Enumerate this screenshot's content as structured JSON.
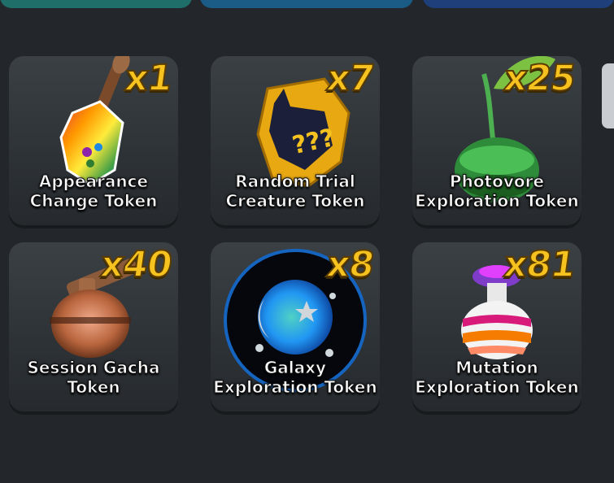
{
  "tabs": [
    "",
    "",
    ""
  ],
  "items": [
    {
      "name_line1": "Appearance",
      "name_line2": "Change Token",
      "count": "x1",
      "icon": "paintbrush-egg-icon"
    },
    {
      "name_line1": "Random Trial",
      "name_line2": "Creature Token",
      "count": "x7",
      "icon": "mystery-creature-icon"
    },
    {
      "name_line1": "Photovore",
      "name_line2": "Exploration Token",
      "count": "x25",
      "icon": "sprout-orb-icon"
    },
    {
      "name_line1": "Session Gacha",
      "name_line2": "Token",
      "count": "x40",
      "icon": "gacha-pot-icon"
    },
    {
      "name_line1": "Galaxy",
      "name_line2": "Exploration Token",
      "count": "x8",
      "icon": "galaxy-orb-icon"
    },
    {
      "name_line1": "Mutation",
      "name_line2": "Exploration Token",
      "count": "x81",
      "icon": "mutation-potion-icon"
    }
  ]
}
